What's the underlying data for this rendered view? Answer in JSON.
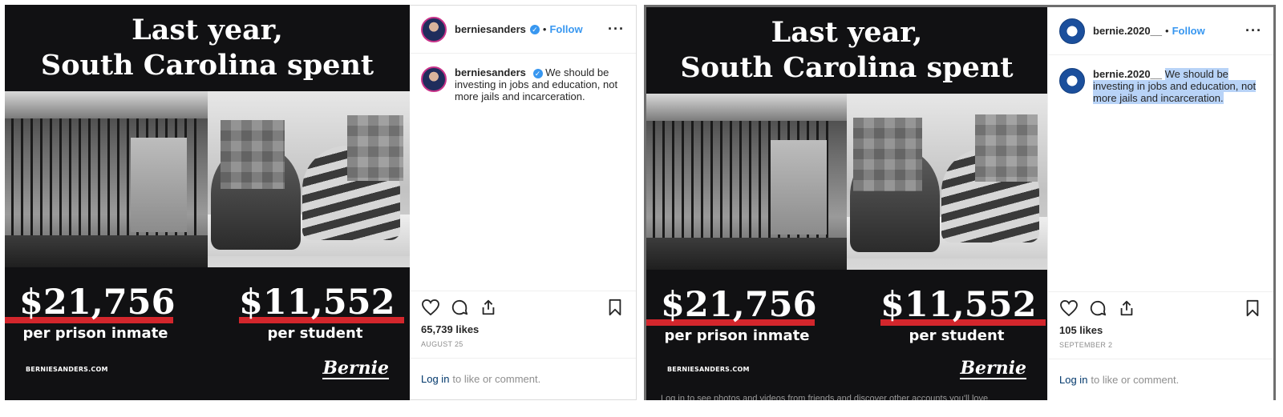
{
  "ad": {
    "headline_line1": "Last year,",
    "headline_line2": "South Carolina spent",
    "stat1_value": "$21,756",
    "stat1_label": "per prison inmate",
    "stat2_value": "$11,552",
    "stat2_label": "per student",
    "url": "BERNIESANDERS.COM",
    "logo": "Bernie",
    "accent_color": "#d3262c"
  },
  "left_post": {
    "username": "berniesanders",
    "verified": true,
    "separator": "•",
    "follow_label": "Follow",
    "more_icon": "more-horizontal-icon",
    "caption": "We should be investing in jobs and education, not more jails and incarceration.",
    "likes": "65,739 likes",
    "date": "AUGUST 25",
    "login_link": "Log in",
    "login_text": "to like or comment."
  },
  "right_post": {
    "username": "bernie.2020__",
    "separator": "•",
    "follow_label": "Follow",
    "more_icon": "more-horizontal-icon",
    "caption": "We should be investing in jobs and education, not more jails and incarceration.",
    "likes": "105 likes",
    "date": "SEPTEMBER 2",
    "login_link": "Log in",
    "login_text": "to like or comment.",
    "background_text": "Log in to see photos and videos from friends and discover other accounts you'll love."
  },
  "icons": [
    "heart-icon",
    "comment-icon",
    "share-icon",
    "bookmark-icon"
  ],
  "colors": {
    "link_blue": "#3897f0",
    "highlight": "#b8d3f7",
    "muted": "#8e8e8e"
  }
}
